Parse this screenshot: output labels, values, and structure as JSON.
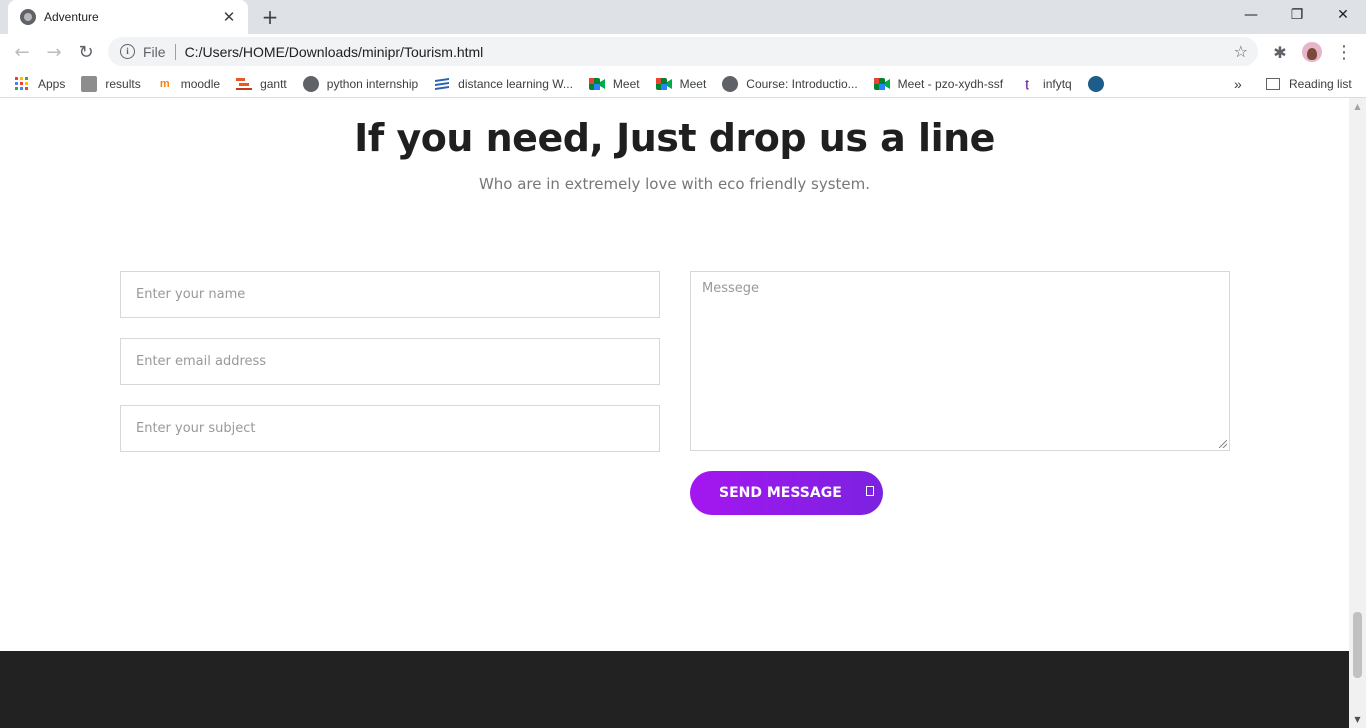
{
  "browser": {
    "tab_title": "Adventure",
    "tab_close": "✕",
    "new_tab": "+",
    "minimize": "—",
    "restore": "❐",
    "close": "✕",
    "back": "←",
    "forward": "→",
    "reload": "↻",
    "site_info": "i",
    "scheme": "File",
    "url": "C:/Users/HOME/Downloads/minipr/Tourism.html",
    "bookmark_star": "☆",
    "extensions": "✱",
    "menu": "⋮",
    "bookmarks": [
      {
        "label": "Apps",
        "icon": "apps-grid-icon"
      },
      {
        "label": "results",
        "icon": "results-icon"
      },
      {
        "label": "moodle",
        "icon": "moodle-icon"
      },
      {
        "label": "gantt",
        "icon": "gantt-icon"
      },
      {
        "label": "python internship",
        "icon": "globe-icon"
      },
      {
        "label": "distance learning W...",
        "icon": "stack-icon"
      },
      {
        "label": "Meet",
        "icon": "meet-icon"
      },
      {
        "label": "Meet",
        "icon": "meet-icon"
      },
      {
        "label": "Course: Introductio...",
        "icon": "globe-icon"
      },
      {
        "label": "Meet - pzo-xydh-ssf",
        "icon": "meet-icon"
      },
      {
        "label": "infytq",
        "icon": "infytq-icon"
      },
      {
        "label": "",
        "icon": "circle-logo-icon"
      }
    ],
    "overflow": "»",
    "reading_list": "Reading list"
  },
  "page": {
    "heading": "If you need, Just drop us a line",
    "subheading": "Who are in extremely love with eco friendly system.",
    "form": {
      "name_placeholder": "Enter your name",
      "email_placeholder": "Enter email address",
      "subject_placeholder": "Enter your subject",
      "message_placeholder": "Messege",
      "send_label": "SEND MESSAGE"
    }
  },
  "colors": {
    "button_gradient_start": "#a416f0",
    "button_gradient_end": "#7b22e0",
    "footer": "#222222"
  }
}
